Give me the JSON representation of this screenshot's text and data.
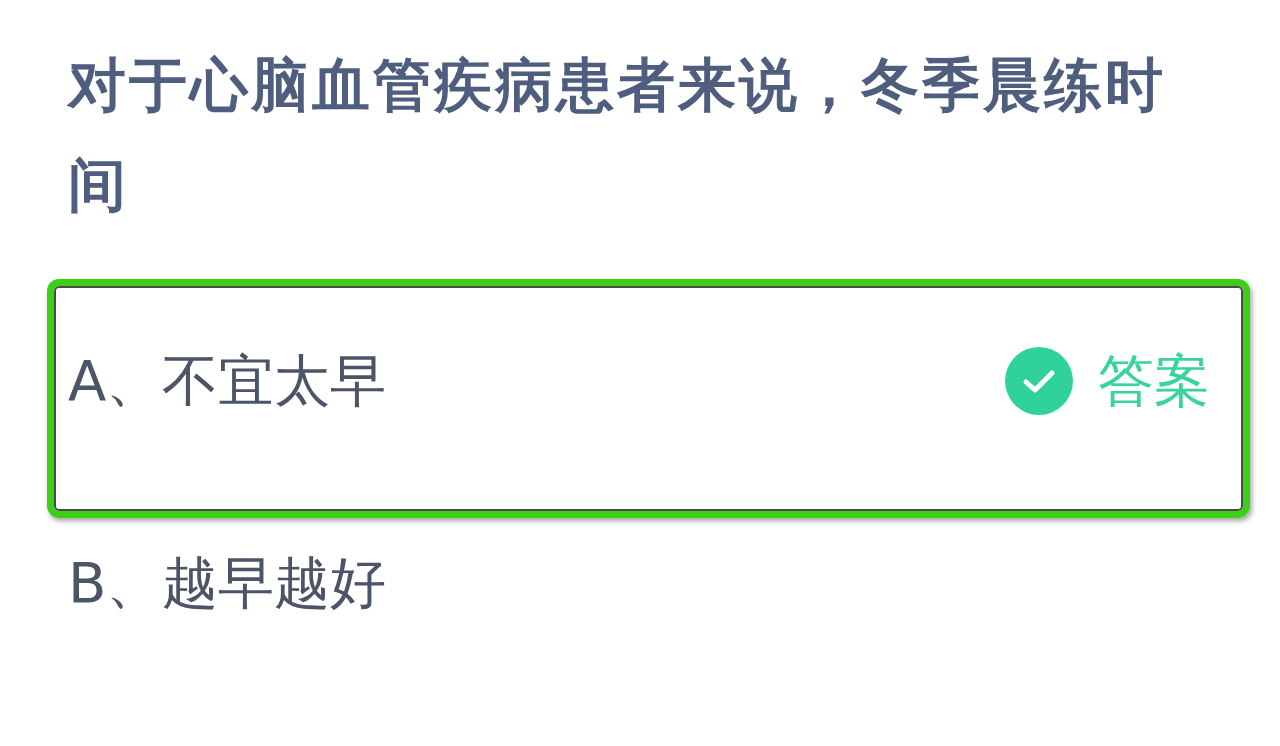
{
  "question": {
    "text": "对于心脑血管疾病患者来说，冬季晨练时间"
  },
  "options": [
    {
      "label": "A、不宜太早",
      "highlighted": true,
      "correct": true,
      "badge": "答案"
    },
    {
      "label": "B、越早越好",
      "highlighted": false,
      "correct": false
    }
  ]
}
